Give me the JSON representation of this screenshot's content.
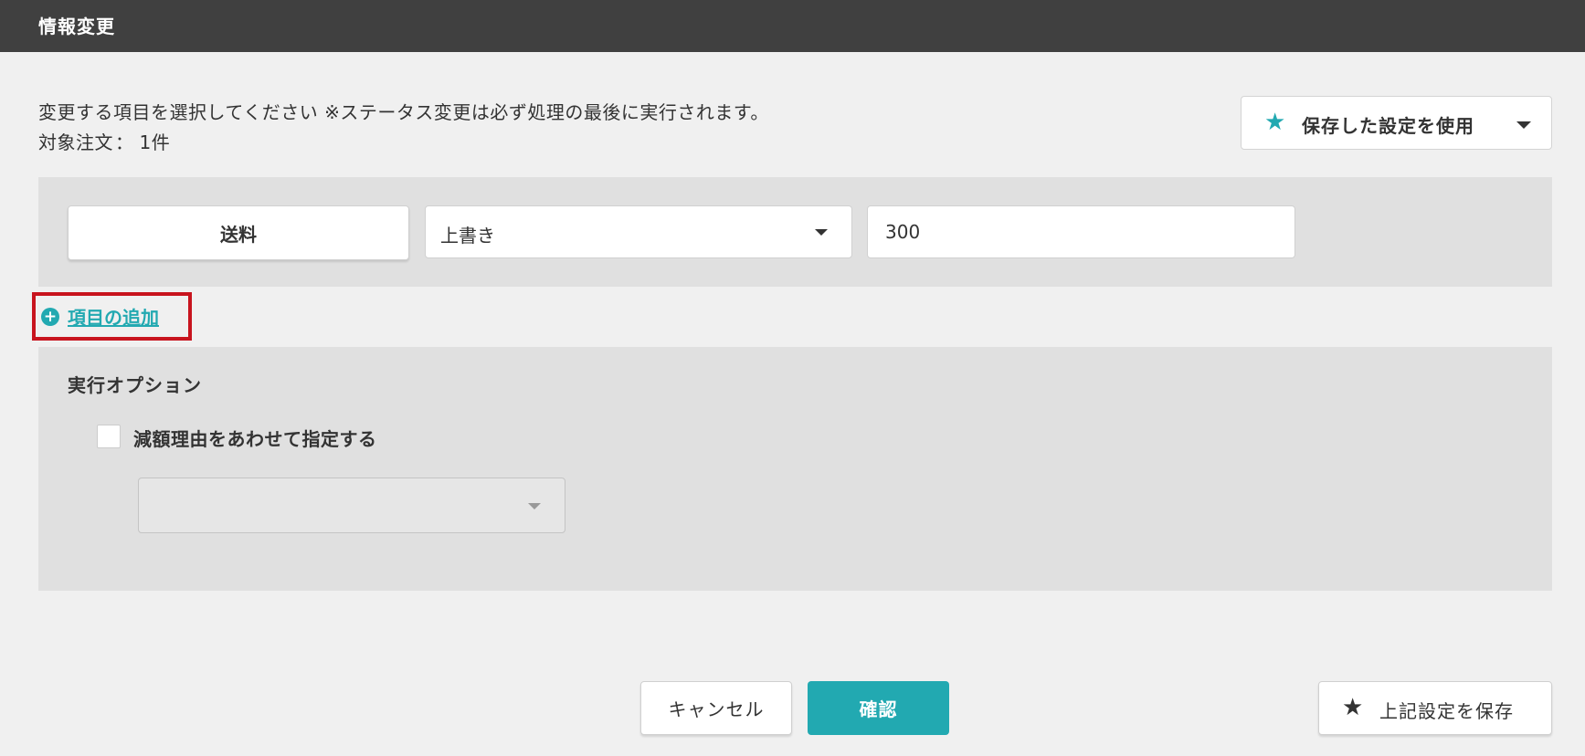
{
  "header": {
    "title": "情報変更"
  },
  "instruction": "変更する項目を選択してください ※ステータス変更は必ず処理の最後に実行されます。",
  "target": {
    "label": "対象注文",
    "separator": "：",
    "count": "1件"
  },
  "saved_settings": {
    "label": "保存した設定を使用",
    "icon": "star-icon",
    "icon_color": "#22a9b1"
  },
  "item_row": {
    "field": "送料",
    "mode": "上書き",
    "value": "300"
  },
  "add_item": {
    "label": "項目の追加",
    "icon": "plus-circle-icon",
    "highlight_color": "#c8141e"
  },
  "options": {
    "heading": "実行オプション",
    "checkbox_label": "減額理由をあわせて指定する",
    "checkbox_checked": false,
    "reason_select_value": ""
  },
  "footer": {
    "cancel": "キャンセル",
    "confirm": "確認",
    "save": "上記設定を保存"
  },
  "colors": {
    "accent": "#22a9b1",
    "header_bg": "#404040",
    "page_bg": "#f0f0f0",
    "panel_bg": "#e0e0e0"
  }
}
